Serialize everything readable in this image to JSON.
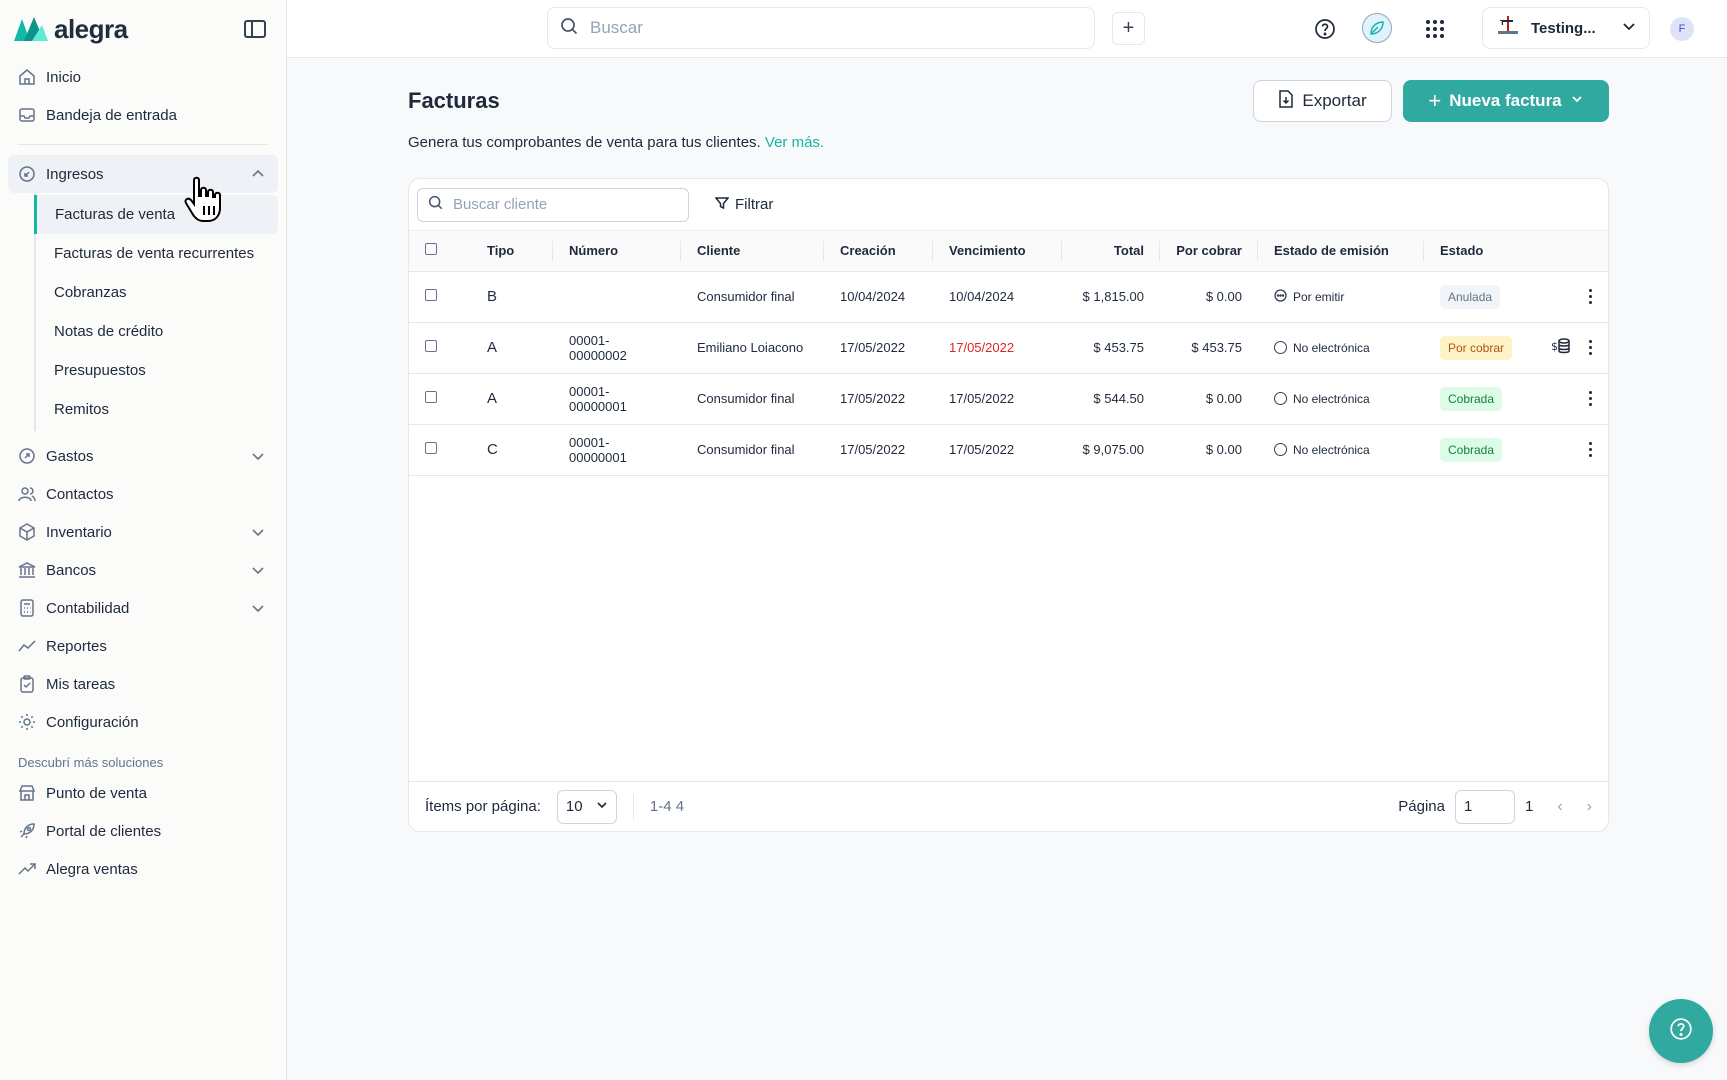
{
  "brand": {
    "name": "alegra",
    "accent": "#30a9a0"
  },
  "sidebar": {
    "items_top": [
      {
        "label": "Inicio",
        "icon": "home-icon"
      },
      {
        "label": "Bandeja de entrada",
        "icon": "inbox-icon"
      }
    ],
    "ingresos": {
      "label": "Ingresos",
      "icon": "income-icon",
      "subitems": [
        "Facturas de venta",
        "Facturas de venta recurrentes",
        "Cobranzas",
        "Notas de crédito",
        "Presupuestos",
        "Remitos"
      ]
    },
    "items_bottom": [
      {
        "label": "Gastos",
        "icon": "expenses-icon",
        "expandable": true
      },
      {
        "label": "Contactos",
        "icon": "contacts-icon",
        "expandable": false
      },
      {
        "label": "Inventario",
        "icon": "box-icon",
        "expandable": true
      },
      {
        "label": "Bancos",
        "icon": "bank-icon",
        "expandable": true
      },
      {
        "label": "Contabilidad",
        "icon": "calculator-icon",
        "expandable": true
      },
      {
        "label": "Reportes",
        "icon": "chart-line-icon",
        "expandable": false
      },
      {
        "label": "Mis tareas",
        "icon": "clipboard-icon",
        "expandable": false
      },
      {
        "label": "Configuración",
        "icon": "gear-icon",
        "expandable": false
      }
    ],
    "solutions_label": "Descubrí más soluciones",
    "solutions": [
      {
        "label": "Punto de venta",
        "icon": "store-icon"
      },
      {
        "label": "Portal de clientes",
        "icon": "rocket-icon"
      },
      {
        "label": "Alegra ventas",
        "icon": "trend-icon"
      }
    ]
  },
  "topbar": {
    "search_placeholder": "Buscar",
    "company": "Testing...",
    "avatar": "F"
  },
  "page": {
    "title": "Facturas",
    "subtitle": "Genera tus comprobantes de venta para tus clientes.",
    "subtitle_link": "Ver más.",
    "export_label": "Exportar",
    "new_label": "Nueva factura",
    "client_search_placeholder": "Buscar cliente",
    "filter_label": "Filtrar"
  },
  "table": {
    "columns": [
      "Tipo",
      "Número",
      "Cliente",
      "Creación",
      "Vencimiento",
      "Total",
      "Por cobrar",
      "Estado de emisión",
      "Estado"
    ],
    "rows": [
      {
        "tipo": "B",
        "numero1": "",
        "numero2": "",
        "cliente": "Consumidor final",
        "creacion": "10/04/2024",
        "vencimiento": "10/04/2024",
        "total": "$ 1,815.00",
        "por_cobrar": "$ 0.00",
        "emision": "Por emitir",
        "estado": "Anulada",
        "estado_color": "gray",
        "overdue": false,
        "pay_icon": false
      },
      {
        "tipo": "A",
        "numero1": "00001-",
        "numero2": "00000002",
        "cliente": "Emiliano Loiacono",
        "creacion": "17/05/2022",
        "vencimiento": "17/05/2022",
        "total": "$ 453.75",
        "por_cobrar": "$ 453.75",
        "emision": "No electrónica",
        "estado": "Por cobrar",
        "estado_color": "yellow",
        "overdue": true,
        "pay_icon": true
      },
      {
        "tipo": "A",
        "numero1": "00001-",
        "numero2": "00000001",
        "cliente": "Consumidor final",
        "creacion": "17/05/2022",
        "vencimiento": "17/05/2022",
        "total": "$ 544.50",
        "por_cobrar": "$ 0.00",
        "emision": "No electrónica",
        "estado": "Cobrada",
        "estado_color": "green",
        "overdue": false,
        "pay_icon": false
      },
      {
        "tipo": "C",
        "numero1": "00001-",
        "numero2": "00000001",
        "cliente": "Consumidor final",
        "creacion": "17/05/2022",
        "vencimiento": "17/05/2022",
        "total": "$ 9,075.00",
        "por_cobrar": "$ 0.00",
        "emision": "No electrónica",
        "estado": "Cobrada",
        "estado_color": "green",
        "overdue": false,
        "pay_icon": false
      }
    ]
  },
  "footer": {
    "per_page_label": "Ítems por página:",
    "per_page_value": "10",
    "range": "1-4 4",
    "page_label": "Página",
    "page_value": "1",
    "page_total": "1"
  }
}
